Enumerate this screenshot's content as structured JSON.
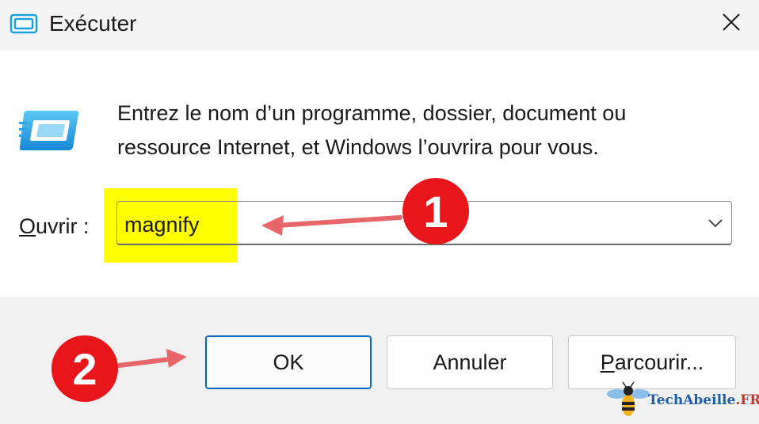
{
  "window": {
    "title": "Exécuter",
    "close_icon": "close-icon",
    "app_icon": "run-icon"
  },
  "content": {
    "description": "Entrez le nom d’un programme, dossier, document ou ressource Internet, et Windows l’ouvrira pour vous.",
    "open_label_accesskey": "O",
    "open_label_rest": "uvrir :",
    "combo_value": "magnify",
    "combo_icon": "chevron-down-icon"
  },
  "buttons": {
    "ok": "OK",
    "cancel": "Annuler",
    "browse_accesskey": "P",
    "browse_rest": "arcourir..."
  },
  "annotations": {
    "step1": "1",
    "step2": "2",
    "badge_color": "#e8151b",
    "arrow_color": "#e8656a",
    "highlight_color": "#ffff00"
  },
  "watermark": {
    "text": "TechAbeille",
    "suffix": ".FR"
  }
}
